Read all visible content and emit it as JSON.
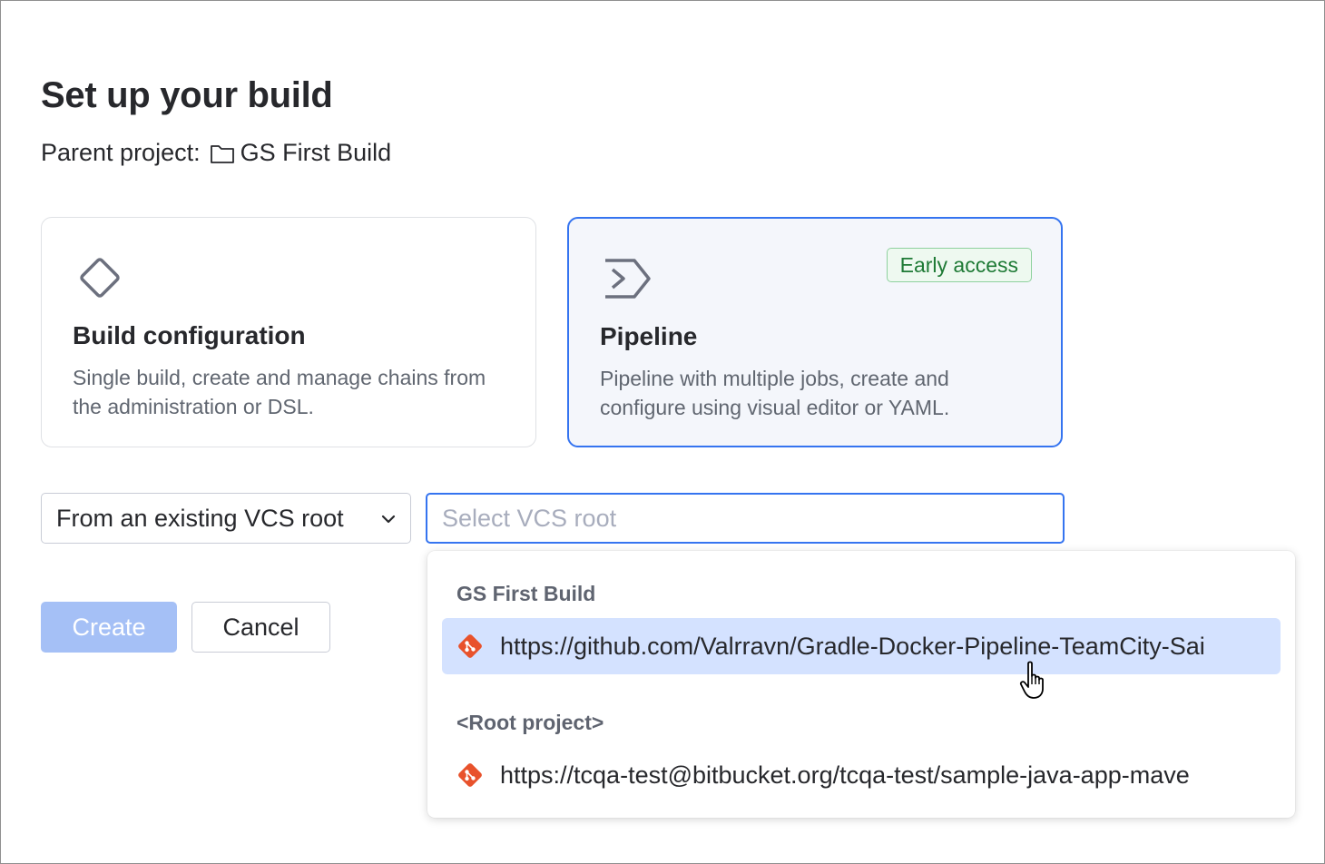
{
  "page": {
    "title": "Set up your build",
    "parent_label": "Parent project:",
    "parent_name": "GS First Build"
  },
  "cards": [
    {
      "title": "Build configuration",
      "description": "Single build, create and manage chains from the administration or DSL.",
      "icon": "diamond-icon",
      "selected": false
    },
    {
      "title": "Pipeline",
      "description": "Pipeline with multiple jobs, create and configure using visual editor or YAML.",
      "icon": "pipeline-icon",
      "badge": "Early access",
      "selected": true
    }
  ],
  "source_select": {
    "value": "From an existing VCS root"
  },
  "vcs_input": {
    "value": "",
    "placeholder": "Select VCS root"
  },
  "buttons": {
    "create": "Create",
    "cancel": "Cancel"
  },
  "dropdown": {
    "groups": [
      {
        "header": "GS First Build",
        "items": [
          {
            "url": "https://github.com/Valrravn/Gradle-Docker-Pipeline-TeamCity-Sai",
            "highlighted": true
          }
        ]
      },
      {
        "header": "<Root project>",
        "items": [
          {
            "url": "https://tcqa-test@bitbucket.org/tcqa-test/sample-java-app-mave",
            "highlighted": false
          }
        ]
      }
    ]
  },
  "colors": {
    "accent": "#3574f0",
    "badge_text": "#1e7a35",
    "git_icon": "#e8522c",
    "highlight": "#d4e2ff"
  }
}
